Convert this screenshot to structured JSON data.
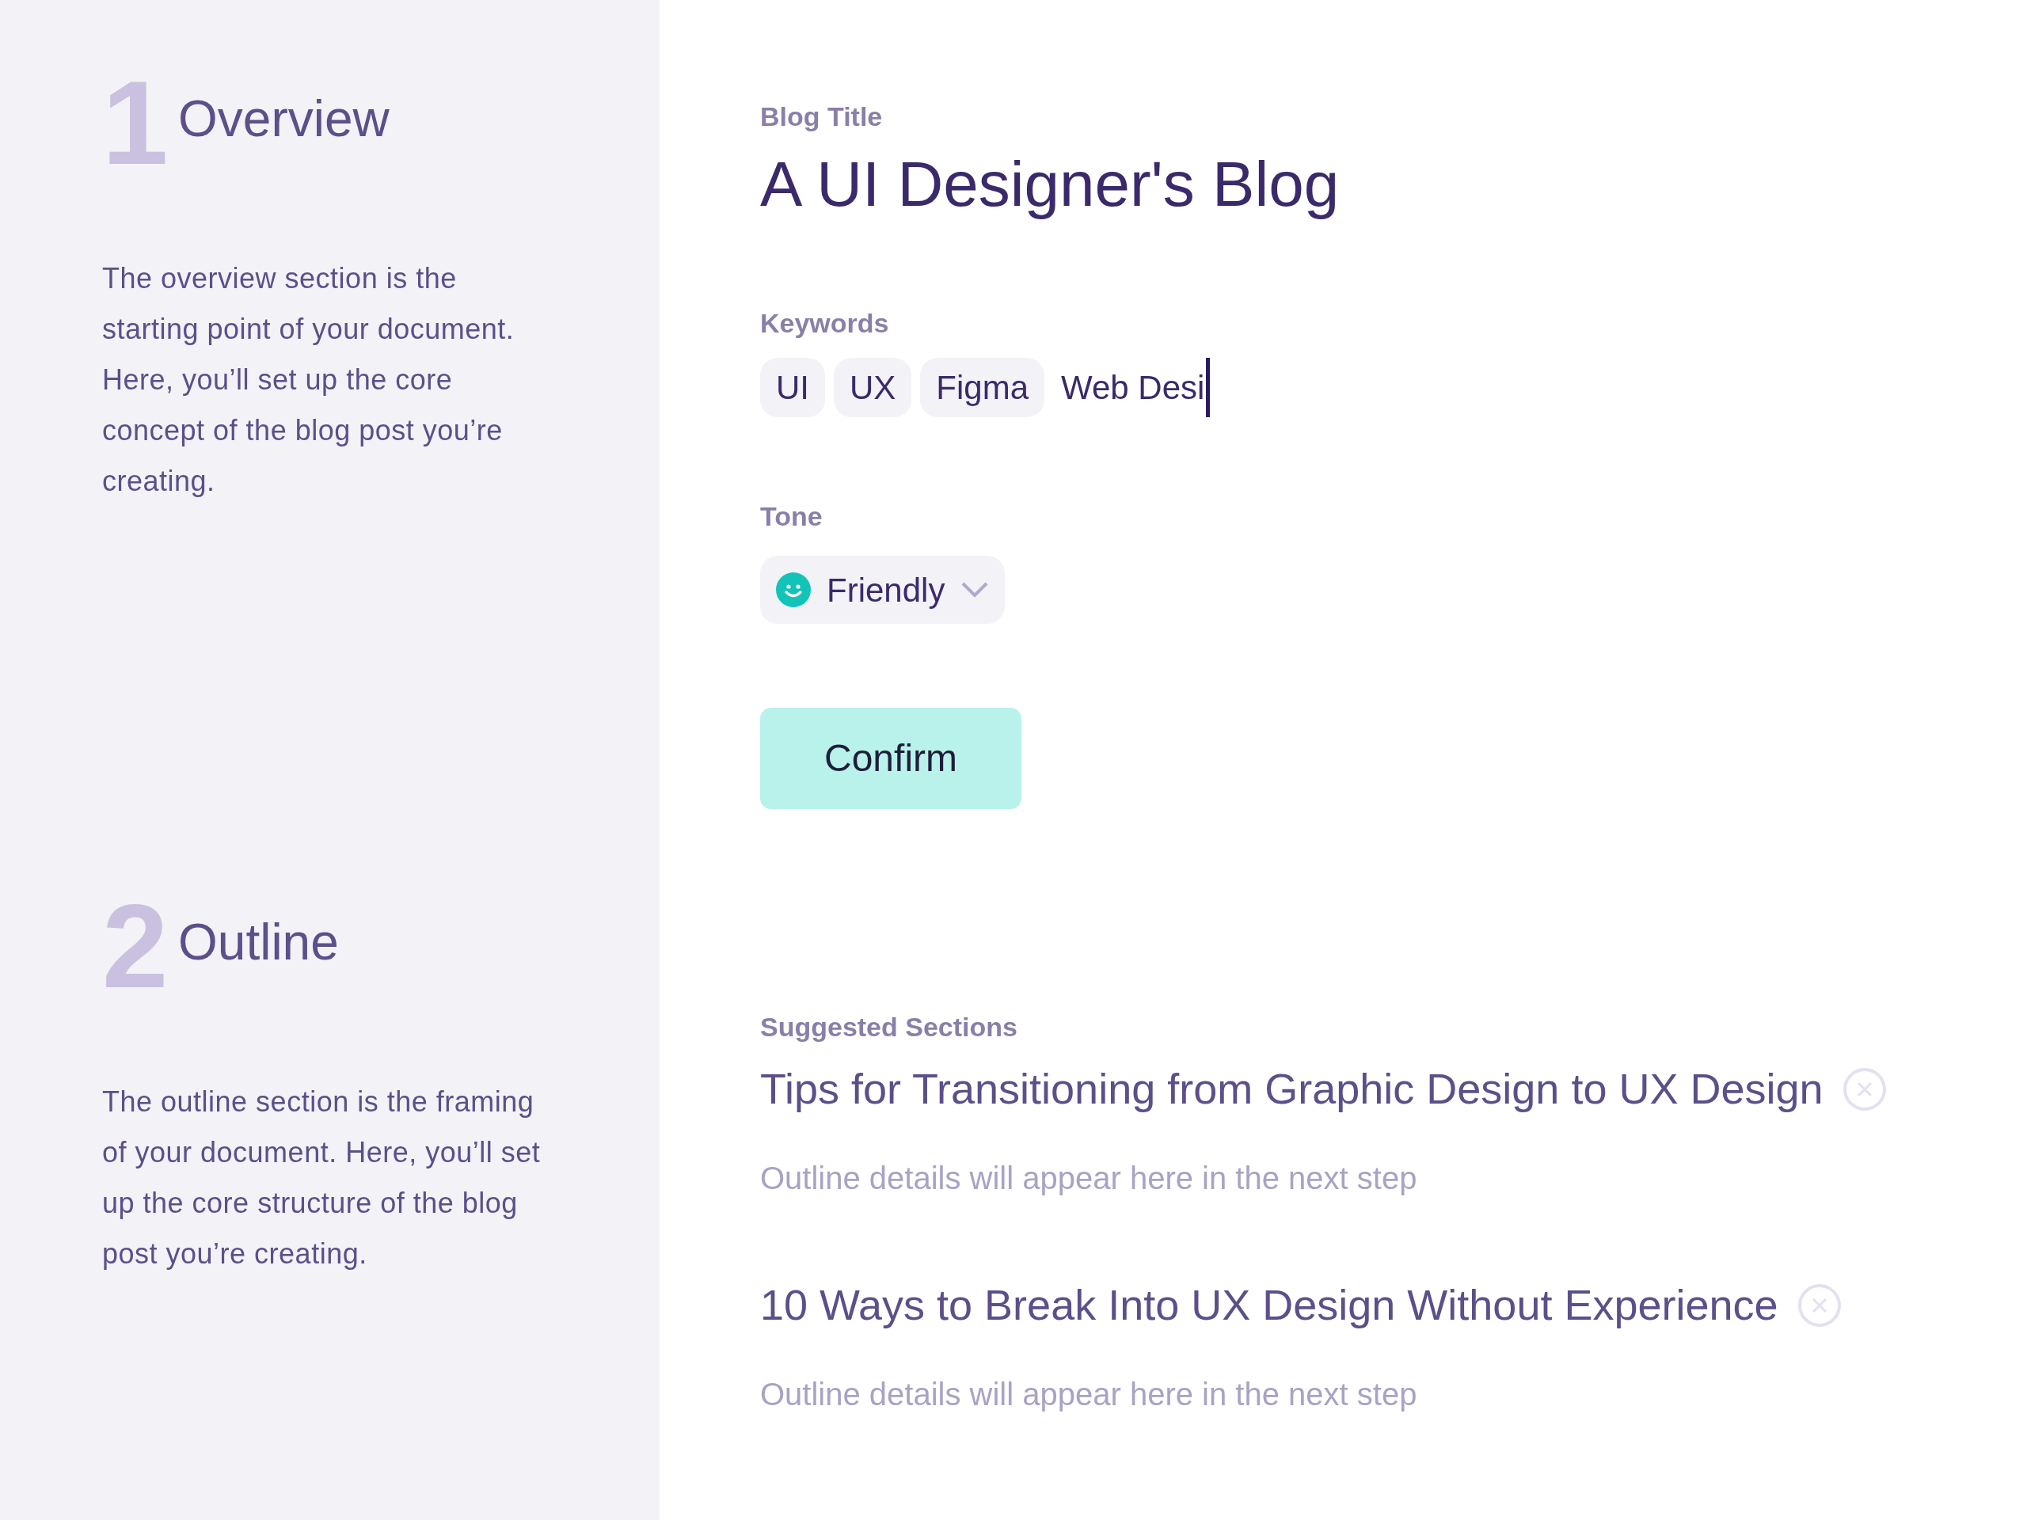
{
  "sidebar": {
    "steps": [
      {
        "number": "1",
        "title": "Overview",
        "description": "The overview section is the starting point of your document. Here, you’ll set up the core concept of the blog post you’re creating."
      },
      {
        "number": "2",
        "title": "Outline",
        "description": "The outline section is the framing of your document. Here, you’ll set up the core structure of the blog post you’re creating."
      }
    ]
  },
  "form": {
    "blog_title": {
      "label": "Blog Title",
      "value": "A UI Designer's Blog"
    },
    "keywords": {
      "label": "Keywords",
      "tags": [
        "UI",
        "UX",
        "Figma"
      ],
      "value": "Web Desi"
    },
    "tone": {
      "label": "Tone",
      "value": "Friendly"
    },
    "confirm_button": "Confirm"
  },
  "suggested": {
    "label": "Suggested Sections",
    "sections": [
      {
        "title": "Tips for Transitioning from Graphic Design to UX Design",
        "detail": "Outline details will appear here in the next step"
      },
      {
        "title": "10 Ways to Break Into UX Design Without Experience",
        "detail": "Outline details will appear here in the next step"
      }
    ]
  }
}
